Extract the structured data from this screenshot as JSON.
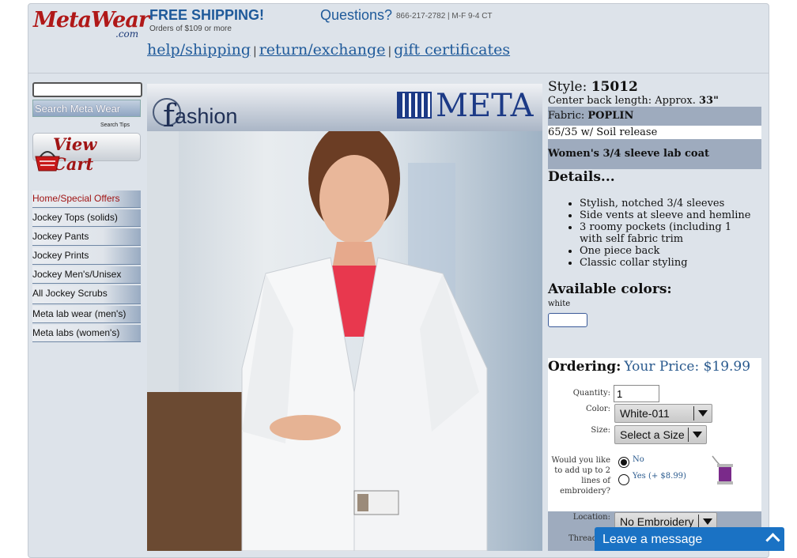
{
  "header": {
    "logo_text_main": "MetaWear",
    "logo_text_com": ".com",
    "shipping_title": "FREE SHIPPING!",
    "shipping_sub": "Orders of $109 or more",
    "questions_title": "Questions?",
    "questions_phone": "866-217-2782 | M-F 9-4 CT",
    "nav": [
      {
        "label": "help/shipping"
      },
      {
        "label": "return/exchange"
      },
      {
        "label": "gift certificates"
      }
    ],
    "nav_separator": "|"
  },
  "sidebar": {
    "search_placeholder": "",
    "search_button": "Search Meta Wear",
    "search_tips": "Search Tips",
    "view_cart": "View Cart",
    "items": [
      {
        "label": "Home/Special Offers"
      },
      {
        "label": "Jockey Tops (solids)"
      },
      {
        "label": "Jockey Pants"
      },
      {
        "label": "Jockey Prints"
      },
      {
        "label": "Jockey Men's/Unisex"
      },
      {
        "label": "All Jockey Scrubs"
      },
      {
        "label": "Meta lab wear (men's)"
      },
      {
        "label": "Meta labs (women's)"
      }
    ]
  },
  "hero": {
    "fashion_text": "ashion",
    "fashion_f": "f",
    "brand": "META"
  },
  "product": {
    "style_label": "Style:",
    "style_number": "15012",
    "cbl_label": "Center back length: Approx.",
    "cbl_value": "33\"",
    "fabric_label": "Fabric:",
    "fabric_value": "POPLIN",
    "blend": "65/35 w/ Soil release",
    "name": "Women's 3/4 sleeve lab coat",
    "details_heading": "Details...",
    "details": [
      "Stylish, notched 3/4 sleeves",
      "Side vents at sleeve and hemline",
      "3 roomy pockets (including 1 with self fabric trim",
      "One piece back",
      "Classic collar styling"
    ],
    "colors_heading": "Available colors:",
    "colors": [
      "white"
    ],
    "swatch_color": "#ffffff"
  },
  "ordering": {
    "heading": "Ordering:",
    "price_text": "Your Price: $19.99",
    "quantity_label": "Quantity:",
    "quantity_value": "1",
    "color_label": "Color:",
    "color_value": "White-011",
    "size_label": "Size:",
    "size_value": "Select a Size",
    "embroidery_label": "Would you like to add up to 2 lines of embroidery?",
    "embroidery_no": "No",
    "embroidery_yes": "Yes (+ $8.99)",
    "location_label": "Location:",
    "location_value": "No Embroidery",
    "thread_label": "Thread Co"
  },
  "chat": {
    "label": "Leave a message",
    "color": "#1a72c4"
  }
}
